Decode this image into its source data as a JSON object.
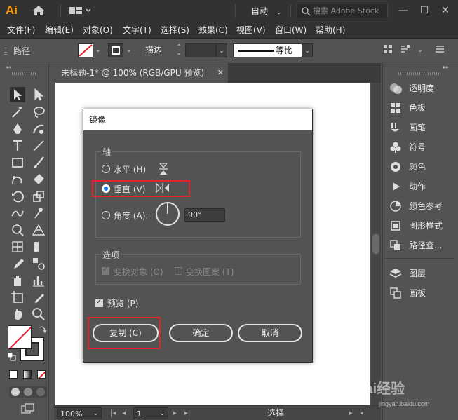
{
  "app": {
    "logo": "Ai",
    "workspace": "自动",
    "search_placeholder": "搜索 Adobe Stock"
  },
  "window_controls": {
    "minimize": "—",
    "maximize": "☐",
    "close": "✕"
  },
  "menu": [
    "文件(F)",
    "编辑(E)",
    "对象(O)",
    "文字(T)",
    "选择(S)",
    "效果(C)",
    "视图(V)",
    "窗口(W)",
    "帮助(H)"
  ],
  "control_bar": {
    "path_label": "路径",
    "stroke_label": "描边",
    "stroke_profile": "等比"
  },
  "document_tab": {
    "title": "未标题-1* @ 100% (RGB/GPU 预览)",
    "close": "✕"
  },
  "status": {
    "zoom": "100%",
    "page": "1",
    "tool": "选择"
  },
  "right_panel": [
    {
      "label": "透明度",
      "icon": "transparency-icon"
    },
    {
      "label": "色板",
      "icon": "swatches-icon"
    },
    {
      "label": "画笔",
      "icon": "brush-icon"
    },
    {
      "label": "符号",
      "icon": "symbol-icon"
    },
    {
      "label": "颜色",
      "icon": "color-icon"
    },
    {
      "label": "动作",
      "icon": "play-icon"
    },
    {
      "label": "颜色参考",
      "icon": "color-guide-icon"
    },
    {
      "label": "图形样式",
      "icon": "graphic-style-icon"
    },
    {
      "label": "路径查...",
      "icon": "pathfinder-icon"
    },
    {
      "label": "图层",
      "icon": "layers-icon"
    },
    {
      "label": "画板",
      "icon": "artboards-icon"
    }
  ],
  "dialog": {
    "title": "镜像",
    "axis_group": "轴",
    "horizontal": "水平 (H)",
    "vertical": "垂直 (V)",
    "angle": "角度 (A):",
    "angle_value": "90°",
    "selected_axis": "vertical",
    "options_group": "选项",
    "transform_objects": "变换对象 (O)",
    "transform_patterns": "变换图案 (T)",
    "preview": "预览 (P)",
    "copy_button": "复制 (C)",
    "ok_button": "确定",
    "cancel_button": "取消"
  },
  "colors": {
    "highlight": "#e8212c",
    "radio_selected": "#1473e6",
    "logo": "#ff9a00"
  },
  "watermark": {
    "brand": "Bai经验",
    "url": "jingyan.baidu.com"
  }
}
